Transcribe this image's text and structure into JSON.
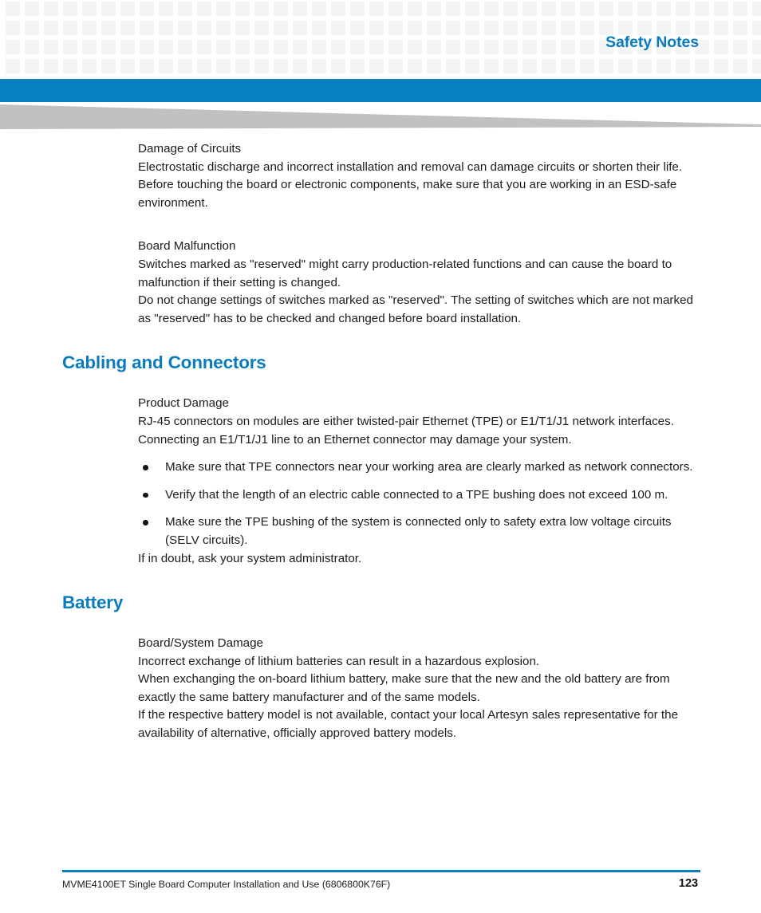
{
  "header": {
    "title": "Safety Notes",
    "accent_blue": "#0880c0",
    "heading_blue": "#0a7cbd",
    "grid_square_color": "#f3f4f4",
    "wedge_gray": "#bfc1c3"
  },
  "sections": [
    {
      "id": "damage-of-circuits",
      "caption": "Damage of Circuits",
      "paragraphs": [
        "Electrostatic discharge and incorrect installation and removal can damage circuits or shorten their life.",
        "Before touching the board or electronic components, make sure that you are working in an ESD-safe environment."
      ]
    },
    {
      "id": "board-malfunction",
      "caption": "Board Malfunction",
      "paragraphs": [
        "Switches marked as \"reserved\" might carry production-related functions and can cause the board to malfunction if their setting is changed.",
        "Do not change settings of switches marked as \"reserved\". The setting of switches which are not marked as \"reserved\" has to be checked and changed before board installation."
      ]
    }
  ],
  "cabling": {
    "heading": "Cabling and Connectors",
    "caption": "Product Damage",
    "intro": "RJ-45 connectors on modules are either twisted-pair Ethernet (TPE) or E1/T1/J1 network interfaces. Connecting an E1/T1/J1 line to an Ethernet connector may damage your system.",
    "bullets": [
      "Make sure that TPE connectors near your working area are clearly marked as network connectors.",
      "Verify that the length of an electric cable connected to a TPE bushing does not exceed 100 m.",
      "Make sure the TPE bushing of the system is connected only to safety extra low voltage circuits (SELV circuits)."
    ],
    "closing": "If in doubt, ask your system administrator."
  },
  "battery": {
    "heading": "Battery",
    "caption": "Board/System Damage",
    "paragraphs": [
      "Incorrect exchange of lithium batteries can result in a hazardous explosion.",
      "When exchanging the on-board lithium battery, make sure that the new and the old battery are from exactly the same battery manufacturer and of the same models.",
      "If the respective battery model is not available, contact your local Artesyn sales representative for the availability of alternative, officially approved battery models."
    ]
  },
  "footer": {
    "document_title": "MVME4100ET Single Board Computer Installation and Use (6806800K76F)",
    "page_number": "123"
  }
}
